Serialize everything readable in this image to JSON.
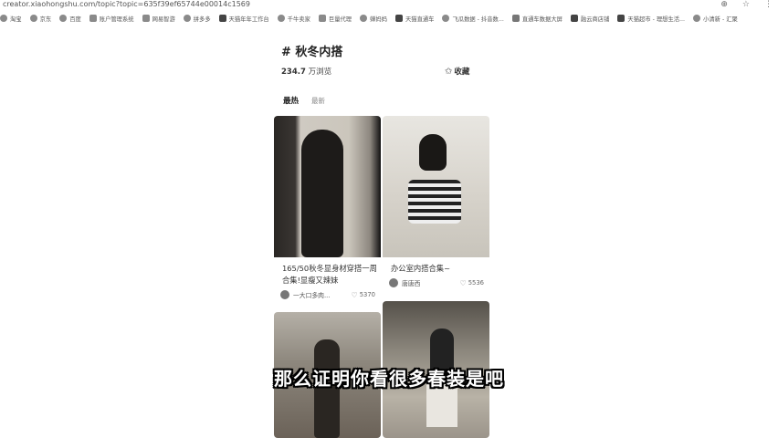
{
  "browser": {
    "url": "creator.xiaohongshu.com/topic?topic=635f39ef65744e00014c1569",
    "bookmarks": [
      "淘宝",
      "京东",
      "百度",
      "账户管理系统",
      "网易智游",
      "拼多多",
      "天猫年年工作台",
      "千牛卖家",
      "巨量代理",
      "蝉妈妈",
      "天猫直通车",
      "飞瓜数据 - 抖音数...",
      "直通车数据大屏",
      "融云商店铺",
      "天猫超市 - 理想生活...",
      "小清新 - 汇聚"
    ]
  },
  "topic": {
    "title": "# 秋冬内搭",
    "views_number": "234.7",
    "views_unit": "万浏览",
    "collect_label": "收藏"
  },
  "tabs": {
    "hot": "最热",
    "new": "最新"
  },
  "cards": [
    {
      "caption": "165/50秋冬显身材穿搭一周合集!显瘦又辣妹",
      "author": "一大口多肉...",
      "likes": "5370"
    },
    {
      "caption": "办公室内搭合集~",
      "author": "唐唐西",
      "likes": "5536"
    },
    {
      "caption": "",
      "author": "",
      "likes": ""
    },
    {
      "caption": "",
      "author": "",
      "likes": ""
    }
  ],
  "subtitle": "那么证明你看很多春装是吧"
}
